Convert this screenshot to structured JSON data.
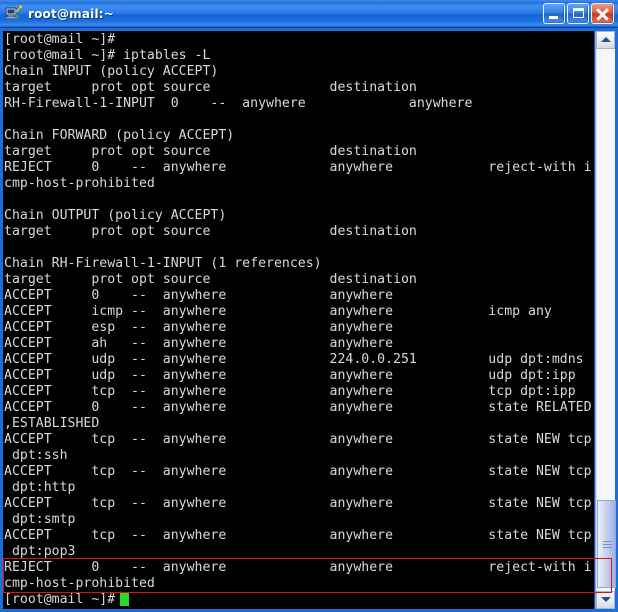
{
  "window": {
    "title": "root@mail:~",
    "icon": "putty-terminal-icon",
    "controls": {
      "minimize_label": "Minimize",
      "maximize_label": "Maximize",
      "close_label": "Close"
    }
  },
  "terminal": {
    "prompt": "[root@mail ~]#",
    "command": "iptables -L",
    "cursor_color": "#2bd82b",
    "background": "#000000",
    "foreground": "#d8d8d8",
    "lines": [
      "[root@mail ~]#",
      "[root@mail ~]# iptables -L",
      "Chain INPUT (policy ACCEPT)",
      "target     prot opt source               destination",
      "RH-Firewall-1-INPUT  0    --  anywhere             anywhere",
      "",
      "Chain FORWARD (policy ACCEPT)",
      "target     prot opt source               destination",
      "REJECT     0    --  anywhere             anywhere            reject-with i",
      "cmp-host-prohibited",
      "",
      "Chain OUTPUT (policy ACCEPT)",
      "target     prot opt source               destination",
      "",
      "Chain RH-Firewall-1-INPUT (1 references)",
      "target     prot opt source               destination",
      "ACCEPT     0    --  anywhere             anywhere",
      "ACCEPT     icmp --  anywhere             anywhere            icmp any",
      "ACCEPT     esp  --  anywhere             anywhere",
      "ACCEPT     ah   --  anywhere             anywhere",
      "ACCEPT     udp  --  anywhere             224.0.0.251         udp dpt:mdns",
      "ACCEPT     udp  --  anywhere             anywhere            udp dpt:ipp",
      "ACCEPT     tcp  --  anywhere             anywhere            tcp dpt:ipp",
      "ACCEPT     0    --  anywhere             anywhere            state RELATED",
      ",ESTABLISHED",
      "ACCEPT     tcp  --  anywhere             anywhere            state NEW tcp",
      " dpt:ssh",
      "ACCEPT     tcp  --  anywhere             anywhere            state NEW tcp",
      " dpt:http",
      "ACCEPT     tcp  --  anywhere             anywhere            state NEW tcp",
      " dpt:smtp",
      "ACCEPT     tcp  --  anywhere             anywhere            state NEW tcp",
      " dpt:pop3",
      "REJECT     0    --  anywhere             anywhere            reject-with i",
      "cmp-host-prohibited",
      "[root@mail ~]# "
    ]
  },
  "scrollbar": {
    "up_arrow": "scroll-up-arrow",
    "down_arrow": "scroll-down-arrow",
    "position": "bottom"
  },
  "annotation": {
    "color": "#e01010",
    "target_text": "REJECT     0    --  anywhere             anywhere            reject-with icmp-host-prohibited"
  }
}
